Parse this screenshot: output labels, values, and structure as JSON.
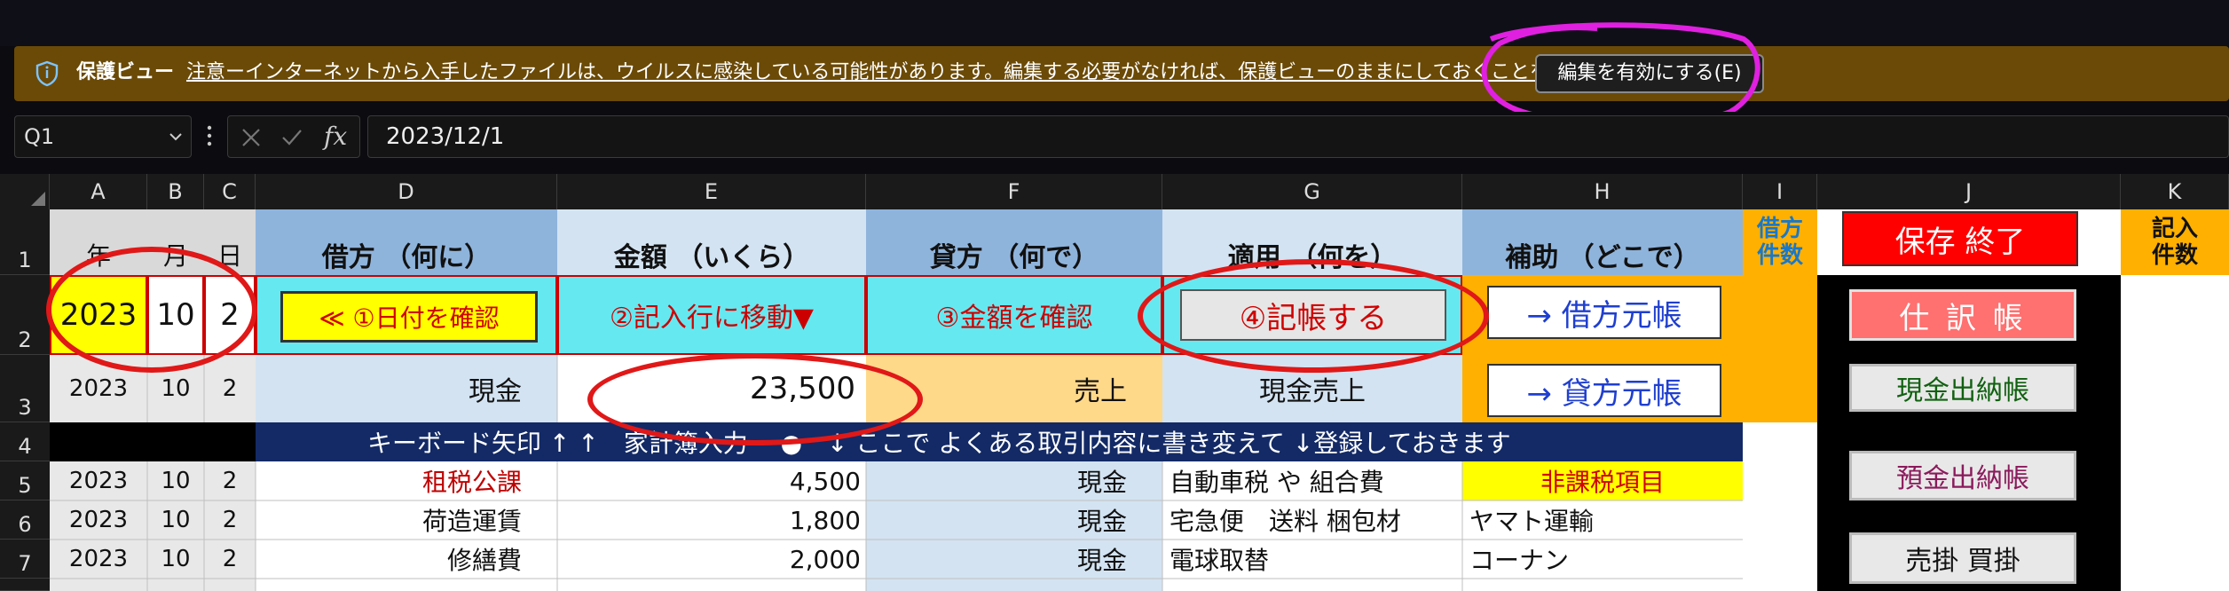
{
  "protected_view": {
    "title": "保護ビュー",
    "message": "注意ーインターネットから入手したファイルは、ウイルスに感染している可能性があります。編集する必要がなければ、保護ビューのままにしておくことをお勧めします。",
    "enable_button": "編集を有効にする(E)"
  },
  "formula_bar": {
    "name_box": "Q1",
    "fx_label": "fx",
    "formula": "2023/12/1"
  },
  "columns": [
    "A",
    "B",
    "C",
    "D",
    "E",
    "F",
    "G",
    "H",
    "I",
    "J",
    "K"
  ],
  "rows": [
    "1",
    "2",
    "3",
    "4",
    "5",
    "6",
    "7"
  ],
  "row1": {
    "year": "年",
    "month": "月",
    "day": "日",
    "debit": "借方 （何に）",
    "amount": "金額 （いくら）",
    "credit": "貸方 （何で）",
    "description": "適用 （何を）",
    "aux": "補助 （どこで）",
    "debit_count": "借方件数",
    "save_exit": "保存 終了",
    "entry_count": "記入件数"
  },
  "row2": {
    "year": "2023",
    "month": "10",
    "day": "2",
    "step1": "≪ ①日付を確認",
    "step2": "②記入行に移動▼",
    "step3": "③金額を確認",
    "step4": "④記帳する",
    "debit_ledger": "→ 借方元帳",
    "journal": "仕 訳 帳"
  },
  "row3": {
    "year": "2023",
    "month": "10",
    "day": "2",
    "debit": "現金",
    "amount": "23,500",
    "credit": "売上",
    "description": "現金売上",
    "credit_ledger": "→ 貸方元帳",
    "cash_book": "現金出納帳"
  },
  "row4": {
    "banner": "キーボード矢印 ↑ ↑　家計簿入力　 ●　↓ ここで よくある取引内容に書き変えて ↓登録しておきます"
  },
  "row5": {
    "year": "2023",
    "month": "10",
    "day": "2",
    "debit": "租税公課",
    "amount": "4,500",
    "credit": "現金",
    "description": "自動車税 や 組合費",
    "aux": "非課税項目",
    "deposit_book": "預金出納帳"
  },
  "row6": {
    "year": "2023",
    "month": "10",
    "day": "2",
    "debit": "荷造運賃",
    "amount": "1,800",
    "credit": "現金",
    "description": "宅急便　送料 梱包材",
    "aux": "ヤマト運輸"
  },
  "row7": {
    "year": "2023",
    "month": "10",
    "day": "2",
    "debit": "修繕費",
    "amount": "2,000",
    "credit": "現金",
    "description": "電球取替",
    "aux": "コーナン",
    "receivable_payable": "売掛 買掛"
  },
  "colors": {
    "header_blue": "#8fb4dc",
    "header_lightblue": "#d3e3f2",
    "cyan": "#66e8f0",
    "orange": "#ffb000",
    "yellow": "#ffff00",
    "red": "#ff0000",
    "annotation_red": "#e01818",
    "annotation_magenta": "#e020e0",
    "protected_bar": "#6b4a07"
  },
  "icons": [
    "shield-icon",
    "chevron-down-icon",
    "more-dots-icon",
    "cancel-x-icon",
    "confirm-check-icon",
    "fx-icon"
  ]
}
